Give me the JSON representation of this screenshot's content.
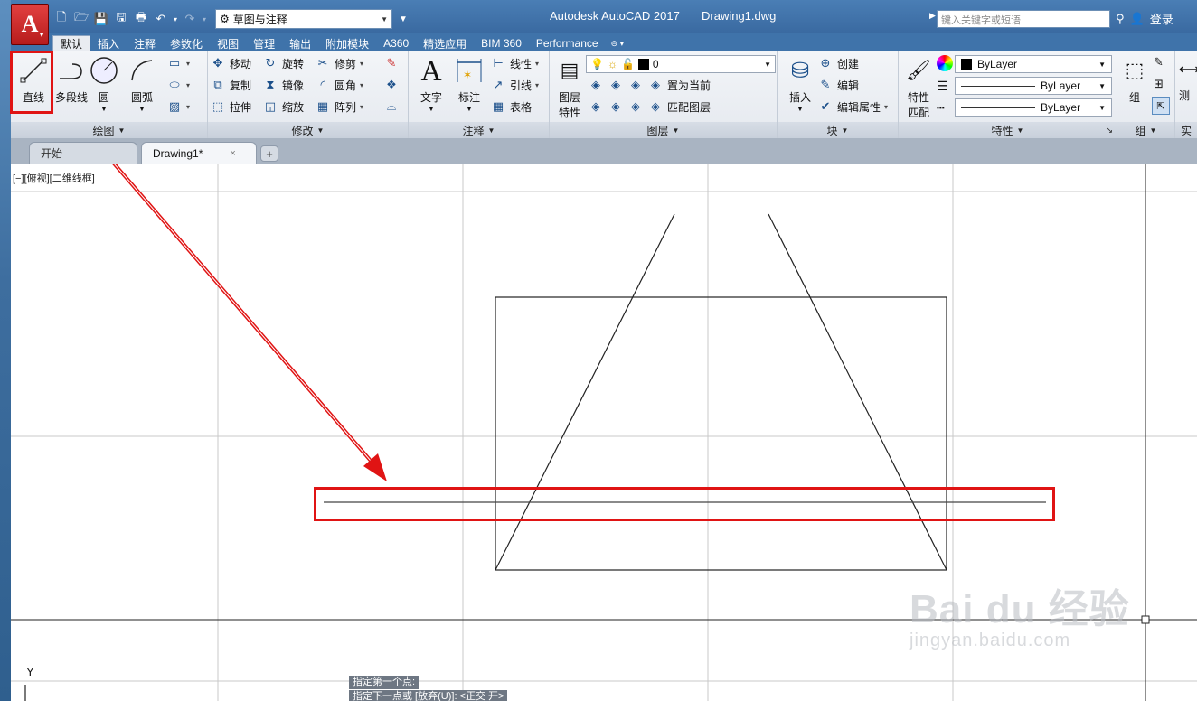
{
  "titlebar": {
    "app_letter": "A",
    "workspace": "草图与注释",
    "app_title": "Autodesk AutoCAD 2017",
    "file_name": "Drawing1.dwg",
    "search_placeholder": "键入关键字或短语",
    "login_label": "登录"
  },
  "tabs": [
    "默认",
    "插入",
    "注释",
    "参数化",
    "视图",
    "管理",
    "输出",
    "附加模块",
    "A360",
    "精选应用",
    "BIM 360",
    "Performance"
  ],
  "ribbon": {
    "draw": {
      "title": "绘图",
      "line_label": "直线",
      "polyline_label": "多段线",
      "circle_label": "圆",
      "arc_label": "圆弧"
    },
    "modify": {
      "title": "修改",
      "move": "移动",
      "rotate": "旋转",
      "trim": "修剪",
      "copy": "复制",
      "mirror": "镜像",
      "fillet": "圆角",
      "stretch": "拉伸",
      "scale": "缩放",
      "array": "阵列"
    },
    "annotation": {
      "title": "注释",
      "text": "文字",
      "dimension": "标注",
      "linear": "线性",
      "leader": "引线",
      "table": "表格"
    },
    "layers": {
      "title": "图层",
      "layer_props_1": "图层",
      "layer_props_2": "特性",
      "current_layer": "0",
      "set_current": "置为当前",
      "match_layer": "匹配图层"
    },
    "block": {
      "title": "块",
      "insert": "插入",
      "create": "创建",
      "edit": "编辑",
      "edit_attr": "编辑属性"
    },
    "properties": {
      "title": "特性",
      "match_1": "特性",
      "match_2": "匹配",
      "color": "ByLayer",
      "linetype": "ByLayer",
      "lineweight": "ByLayer"
    },
    "groups": {
      "title": "组",
      "group": "组"
    },
    "utilities": {
      "title": "实",
      "measure": "测"
    }
  },
  "doc_tabs": {
    "start": "开始",
    "drawing": "Drawing1*",
    "close": "×",
    "add": "+"
  },
  "canvas": {
    "viewport_label": "[−][俯视][二维线框]",
    "ucs_y": "Y",
    "cmd_line_1": "指定第一个点:",
    "cmd_line_2": "指定下一点或 [放弃(U)]:  <正交 开>"
  },
  "watermark": {
    "main": "Bai du 经验",
    "sub": "jingyan.baidu.com"
  },
  "colors": {
    "highlight": "#e01414",
    "title_bar": "#3a6aa1"
  }
}
